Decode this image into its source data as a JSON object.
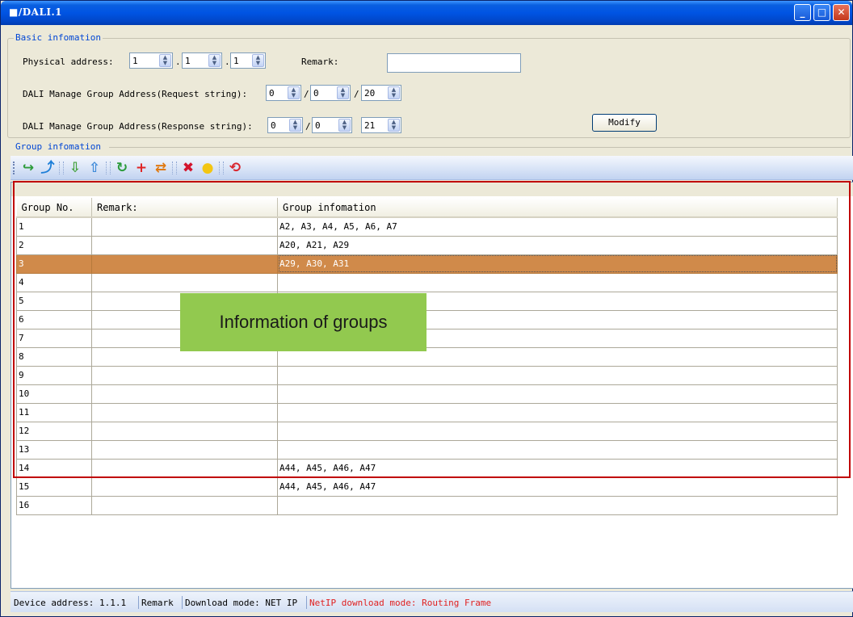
{
  "window": {
    "title": "■/DALI.1",
    "minimize": "_",
    "maximize": "□",
    "close": "✕"
  },
  "basic": {
    "legend": "Basic infomation",
    "physical_label": "Physical address:",
    "physical": [
      "1",
      "1",
      "1"
    ],
    "remark_label": "Remark:",
    "remark_value": "",
    "req_label": "DALI Manage Group Address(Request string):",
    "req": [
      "0",
      "0",
      "20"
    ],
    "resp_label": "DALI Manage Group Address(Response string):",
    "resp": [
      "0",
      "0",
      "21"
    ],
    "dot": ".",
    "slash": "/",
    "modify_label": "Modify"
  },
  "group": {
    "legend": "Group infomation",
    "toolbar": [
      {
        "name": "import-icon",
        "glyph": "↪",
        "color": "#2e9c3a"
      },
      {
        "name": "export-icon",
        "glyph": "⤴",
        "color": "#1e7fd8"
      },
      {
        "name": "download-icon",
        "glyph": "⇩",
        "color": "#44a23c"
      },
      {
        "name": "upload-icon",
        "glyph": "⇧",
        "color": "#3f8bd9"
      },
      {
        "name": "refresh-icon",
        "glyph": "↻",
        "color": "#2b9b3b"
      },
      {
        "name": "add-icon",
        "glyph": "+",
        "color": "#e02424"
      },
      {
        "name": "swap-icon",
        "glyph": "⇄",
        "color": "#e07a12"
      },
      {
        "name": "delete-icon",
        "glyph": "✖",
        "color": "#d3152d"
      },
      {
        "name": "bulb-icon",
        "glyph": "●",
        "color": "#f3c613"
      },
      {
        "name": "reset-icon",
        "glyph": "⟲",
        "color": "#d9262e"
      }
    ],
    "columns": [
      "Group No.",
      "Remark:",
      "Group infomation"
    ],
    "rows": [
      {
        "no": "1",
        "remark": "",
        "info": "A2, A3, A4, A5, A6, A7"
      },
      {
        "no": "2",
        "remark": "",
        "info": "A20, A21, A29"
      },
      {
        "no": "3",
        "remark": "",
        "info": "A29, A30, A31"
      },
      {
        "no": "4",
        "remark": "",
        "info": ""
      },
      {
        "no": "5",
        "remark": "",
        "info": ""
      },
      {
        "no": "6",
        "remark": "",
        "info": ""
      },
      {
        "no": "7",
        "remark": "",
        "info": ""
      },
      {
        "no": "8",
        "remark": "",
        "info": ""
      },
      {
        "no": "9",
        "remark": "",
        "info": ""
      },
      {
        "no": "10",
        "remark": "",
        "info": ""
      },
      {
        "no": "11",
        "remark": "",
        "info": ""
      },
      {
        "no": "12",
        "remark": "",
        "info": ""
      },
      {
        "no": "13",
        "remark": "",
        "info": ""
      },
      {
        "no": "14",
        "remark": "",
        "info": "A44, A45, A46, A47"
      },
      {
        "no": "15",
        "remark": "",
        "info": "A44, A45, A46, A47"
      },
      {
        "no": "16",
        "remark": "",
        "info": ""
      }
    ],
    "selected_row": "3"
  },
  "callout": {
    "text": "Information of groups",
    "color": "#92c94f"
  },
  "status": {
    "device": "Device address: 1.1.1",
    "remark": "Remark",
    "download": "Download mode: NET IP",
    "netip": "NetIP download mode: Routing Frame",
    "netip_color": "#e02020"
  }
}
